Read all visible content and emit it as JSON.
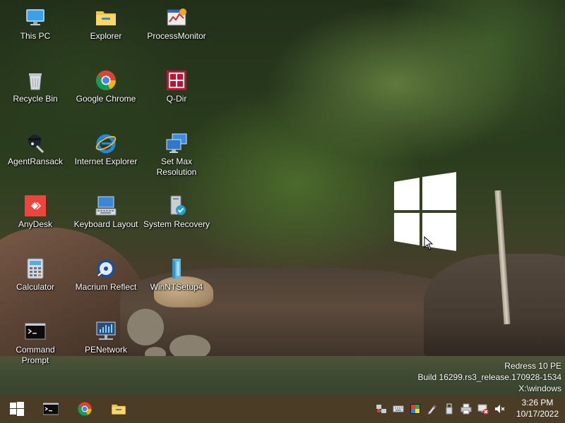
{
  "desktop": {
    "icons": [
      {
        "label": "This PC"
      },
      {
        "label": "Explorer"
      },
      {
        "label": "ProcessMonitor"
      },
      {
        "label": "Recycle Bin"
      },
      {
        "label": "Google Chrome"
      },
      {
        "label": "Q-Dir"
      },
      {
        "label": "AgentRansack"
      },
      {
        "label": "Internet Explorer"
      },
      {
        "label": "Set Max\nResolution"
      },
      {
        "label": "AnyDesk"
      },
      {
        "label": "Keyboard Layout"
      },
      {
        "label": "System Recovery"
      },
      {
        "label": "Calculator"
      },
      {
        "label": "Macrium Reflect"
      },
      {
        "label": "WinNTSetup4"
      },
      {
        "label": "Command\nPrompt"
      },
      {
        "label": "PENetwork"
      }
    ]
  },
  "watermark": {
    "line1": "Redress 10 PE",
    "line2": "Build 16299.rs3_release.170928-1534",
    "line3": "X:\\windows"
  },
  "taskbar": {
    "pinned": [
      "start-icon",
      "command-prompt-icon",
      "chrome-icon",
      "explorer-icon"
    ],
    "tray_icons": [
      "network-icon",
      "keyboard-icon",
      "display-color-icon",
      "pen-icon",
      "usb-icon",
      "printer-icon",
      "network-disconnected-icon",
      "volume-muted-icon"
    ]
  },
  "clock": {
    "time": "3:26 PM",
    "date": "10/17/2022"
  },
  "colors": {
    "taskbar": "#4b3c26",
    "desktop_text": "#ffffff"
  }
}
